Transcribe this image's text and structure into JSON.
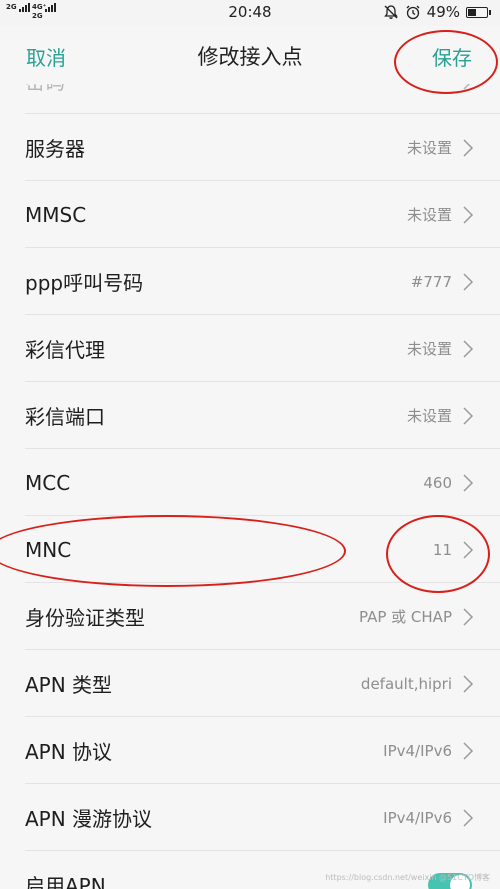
{
  "status_bar": {
    "network_top": "2G",
    "network_bottom": "4G⁺",
    "network_2g": "2G",
    "time": "20:48",
    "battery": "49%",
    "battery_level": 0.49,
    "icons": [
      "silent-bell-icon",
      "alarm-icon",
      "battery-icon"
    ]
  },
  "header": {
    "cancel_label": "取消",
    "title": "修改接入点",
    "save_label": "保存",
    "accent_color": "#2aa193"
  },
  "rows": [
    {
      "label": "密码",
      "value": ""
    },
    {
      "label": "服务器",
      "value": "未设置"
    },
    {
      "label": "MMSC",
      "value": "未设置"
    },
    {
      "label": "ppp呼叫号码",
      "value": "#777"
    },
    {
      "label": "彩信代理",
      "value": "未设置"
    },
    {
      "label": "彩信端口",
      "value": "未设置"
    },
    {
      "label": "MCC",
      "value": "460"
    },
    {
      "label": "MNC",
      "value": "11"
    },
    {
      "label": "身份验证类型",
      "value": "PAP 或 CHAP"
    },
    {
      "label": "APN 类型",
      "value": "default,hipri"
    },
    {
      "label": "APN 协议",
      "value": "IPv4/IPv6"
    },
    {
      "label": "APN 漫游协议",
      "value": "IPv4/IPv6"
    },
    {
      "label": "启用APN",
      "value": ""
    }
  ],
  "enable_apn_on": true,
  "watermark": "https://blog.csdn.net/weixin @51CTO博客"
}
